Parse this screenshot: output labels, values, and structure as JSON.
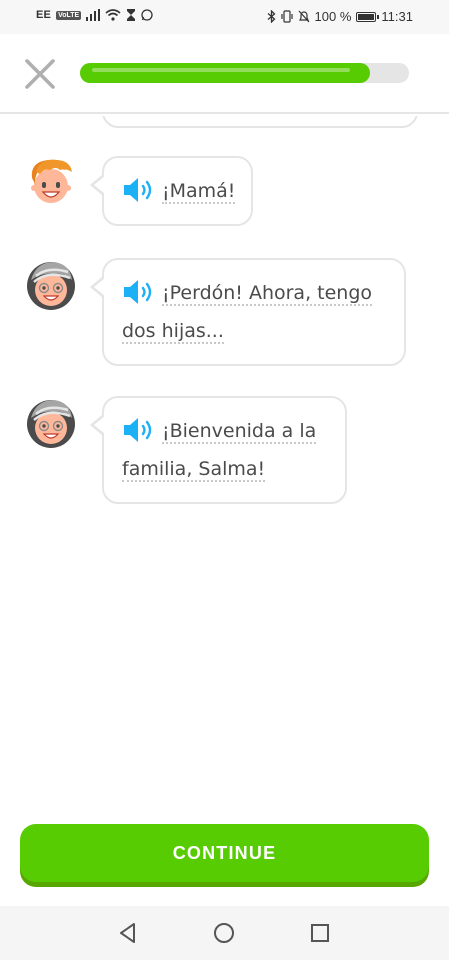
{
  "status_bar": {
    "carrier": "EE",
    "volte": "VoLTE",
    "battery_percent": "100 %",
    "time": "11:31"
  },
  "lesson": {
    "progress": 0.88
  },
  "messages": [
    {
      "speaker": "red-haired-character",
      "lines": [
        "¡Mamá!"
      ]
    },
    {
      "speaker": "grey-haired-character",
      "lines": [
        "¡Perdón! Ahora, tengo",
        "dos hijas..."
      ]
    },
    {
      "speaker": "grey-haired-character",
      "lines": [
        "¡Bienvenida a la",
        "familia, Salma!"
      ]
    }
  ],
  "footer": {
    "continue_label": "CONTINUE"
  },
  "colors": {
    "accent": "#58cc02",
    "accent_shadow": "#58a700",
    "track": "#e5e5e5",
    "speaker": "#1cb0f6"
  }
}
